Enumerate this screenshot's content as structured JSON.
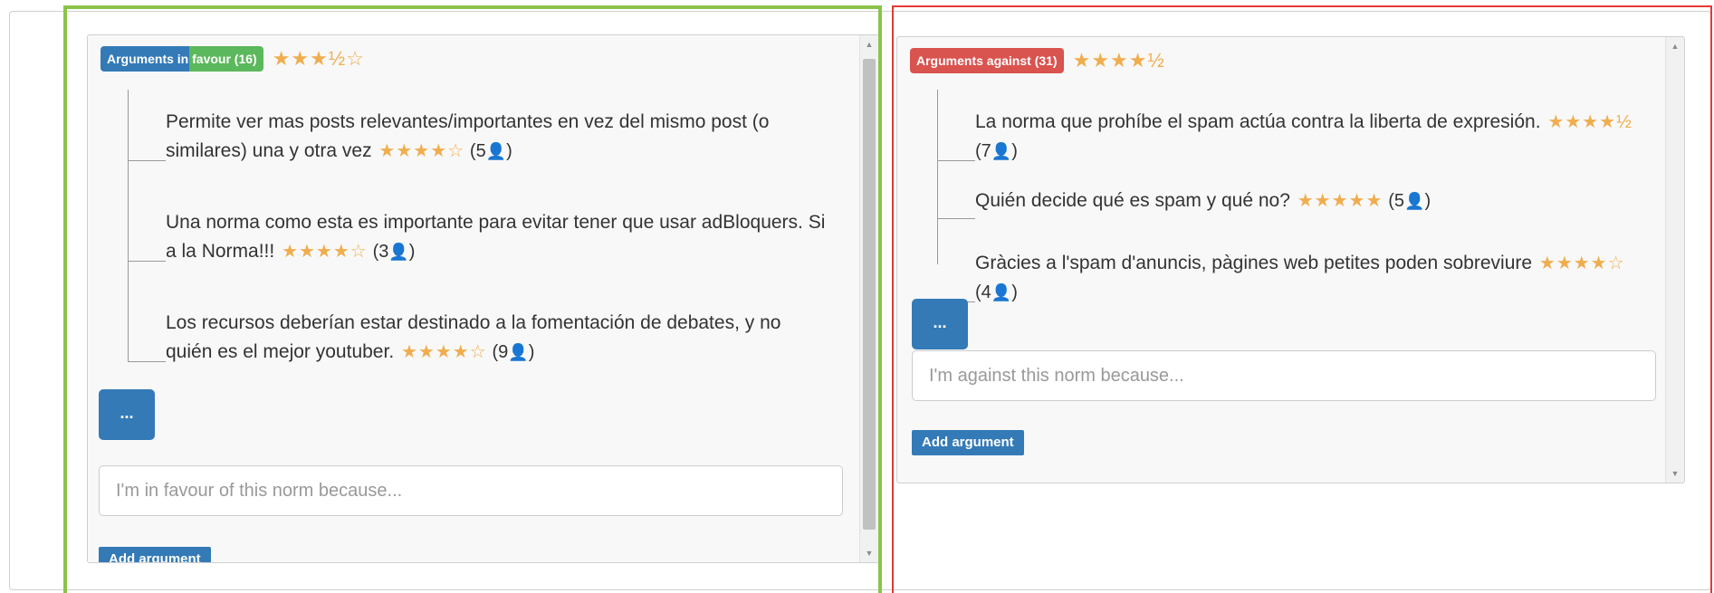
{
  "favour": {
    "badge": "Arguments in favour (16)",
    "rating_stars": "★★★½☆",
    "arguments": [
      {
        "text": "Permite ver mas posts relevantes/importantes en vez del mismo post (o similares) una y otra vez",
        "stars": "★★★★☆",
        "count": "(5"
      },
      {
        "text": "Una norma como esta es importante para evitar tener que usar adBloquers. Si a la Norma!!!",
        "stars": "★★★★☆",
        "count": "(3"
      },
      {
        "text": "Los recursos deberían estar destinado a la fomentación de debates, y no quién es el mejor youtuber.",
        "stars": "★★★★☆",
        "count": "(9"
      }
    ],
    "more_label": "...",
    "input_placeholder": "I'm in favour of this norm because...",
    "add_label": "Add argument"
  },
  "against": {
    "badge": "Arguments against (31)",
    "rating_stars": "★★★★½",
    "arguments": [
      {
        "text": "La norma que prohíbe el spam actúa contra la liberta de expresión.",
        "stars": "★★★★½",
        "count": "(7"
      },
      {
        "text": "Quién decide qué es spam y qué no?",
        "stars": "★★★★★",
        "count": "(5"
      },
      {
        "text": "Gràcies a l'spam d'anuncis, pàgines web petites poden sobreviure",
        "stars": "★★★★☆",
        "count": "(4"
      }
    ],
    "more_label": "...",
    "input_placeholder": "I'm against this norm because...",
    "add_label": "Add argument"
  },
  "icons": {
    "person": "user-icon",
    "scroll_up": "scroll-up-icon",
    "scroll_down": "scroll-down-icon"
  },
  "colors": {
    "primary": "#337ab7",
    "success": "#5cb85c",
    "danger": "#d9534f",
    "star": "#f0ad4e",
    "highlight_green": "#8bc34a",
    "highlight_red": "#e53935"
  }
}
